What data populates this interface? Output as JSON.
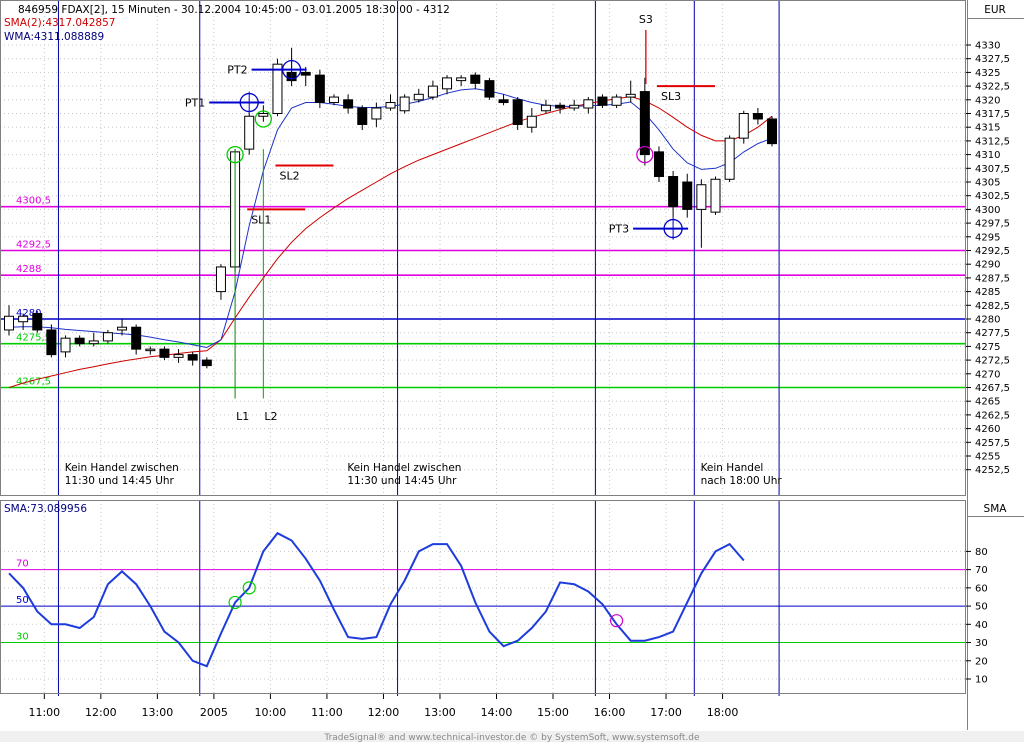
{
  "header": {
    "title": "846959  FDAX[2], 15 Minuten - 30.12.2004 10:45:00 - 03.01.2005 18:30:00 - 4312",
    "sma_label": "SMA(2):4317.042857",
    "wma_label": "WMA:4311.088889",
    "currency": "EUR",
    "title_color": "#000000",
    "sma_color": "#cc0000",
    "wma_color": "#000080"
  },
  "lower_panel": {
    "label": "SMA:73.089956",
    "axis_title": "SMA"
  },
  "footer": {
    "credit": "TradeSignal® and www.technical-investor.de © by SystemSoft, www.systemsoft.de"
  },
  "colors": {
    "up_candle": "#ffffff",
    "down_candle": "#000000",
    "sma_line": "#cc0000",
    "wma_line": "#1e32c8",
    "magenta_level": "#e000e0",
    "green_level": "#00cc00",
    "blue_level": "#0000cc",
    "pt_marker": "#0000cc",
    "sl_marker": "#e00000",
    "entry_circle": "#00cc00",
    "exit_circle": "#cc00cc"
  },
  "chart_data": [
    {
      "type": "candlestick",
      "title": "846959  FDAX[2], 15 Minuten",
      "ylim": [
        4250,
        4335
      ],
      "y_ticks": [
        "4252,5",
        "4255",
        "4257,5",
        "4260",
        "4262,5",
        "4265",
        "4267,5",
        "4270",
        "4272,5",
        "4275",
        "4277,5",
        "4280",
        "4282,5",
        "4285",
        "4287,5",
        "4290",
        "4292,5",
        "4295",
        "4297,5",
        "4300",
        "4302,5",
        "4305",
        "4307,5",
        "4310",
        "4312,5",
        "4315",
        "4317,5",
        "4320",
        "4322,5",
        "4325",
        "4327,5",
        "4330"
      ],
      "x_tick_labels": [
        "11:00",
        "12:00",
        "13:00",
        "2005",
        "10:00",
        "11:00",
        "12:00",
        "13:00",
        "14:00",
        "15:00",
        "16:00",
        "17:00",
        "18:00"
      ],
      "x_tick_bars": [
        2.5,
        6.5,
        10.5,
        14.5,
        18.5,
        22.5,
        26.5,
        30.5,
        34.5,
        38.5,
        42.5,
        46.5,
        50.5
      ],
      "candles": [
        {
          "o": 4278.0,
          "h": 4282.5,
          "l": 4277.0,
          "c": 4280.5
        },
        {
          "o": 4279.5,
          "h": 4281.0,
          "l": 4278.0,
          "c": 4280.5
        },
        {
          "o": 4281.0,
          "h": 4281.5,
          "l": 4277.5,
          "c": 4278.0
        },
        {
          "o": 4278.0,
          "h": 4279.0,
          "l": 4273.0,
          "c": 4273.5
        },
        {
          "o": 4274.0,
          "h": 4277.0,
          "l": 4273.0,
          "c": 4276.5
        },
        {
          "o": 4276.5,
          "h": 4277.0,
          "l": 4275.0,
          "c": 4275.5
        },
        {
          "o": 4275.5,
          "h": 4277.5,
          "l": 4275.0,
          "c": 4276.0
        },
        {
          "o": 4276.0,
          "h": 4278.0,
          "l": 4275.5,
          "c": 4277.5
        },
        {
          "o": 4278.0,
          "h": 4280.0,
          "l": 4277.0,
          "c": 4278.5
        },
        {
          "o": 4278.5,
          "h": 4279.0,
          "l": 4273.5,
          "c": 4274.5
        },
        {
          "o": 4274.5,
          "h": 4275.0,
          "l": 4273.5,
          "c": 4274.5
        },
        {
          "o": 4274.5,
          "h": 4275.0,
          "l": 4272.5,
          "c": 4273.0
        },
        {
          "o": 4273.0,
          "h": 4274.5,
          "l": 4272.0,
          "c": 4273.5
        },
        {
          "o": 4273.5,
          "h": 4274.0,
          "l": 4271.5,
          "c": 4272.5
        },
        {
          "o": 4272.5,
          "h": 4273.0,
          "l": 4271.0,
          "c": 4271.5
        },
        {
          "o": 4285.0,
          "h": 4290.0,
          "l": 4283.5,
          "c": 4289.5
        },
        {
          "o": 4289.5,
          "h": 4311.0,
          "l": 4288.5,
          "c": 4310.5
        },
        {
          "o": 4311.0,
          "h": 4317.5,
          "l": 4310.0,
          "c": 4317.0
        },
        {
          "o": 4317.0,
          "h": 4319.0,
          "l": 4316.0,
          "c": 4317.5
        },
        {
          "o": 4317.5,
          "h": 4327.5,
          "l": 4317.0,
          "c": 4326.5
        },
        {
          "o": 4325.0,
          "h": 4329.5,
          "l": 4322.5,
          "c": 4323.5
        },
        {
          "o": 4325.0,
          "h": 4326.0,
          "l": 4322.5,
          "c": 4324.5
        },
        {
          "o": 4324.5,
          "h": 4325.5,
          "l": 4318.5,
          "c": 4319.5
        },
        {
          "o": 4319.5,
          "h": 4321.0,
          "l": 4319.0,
          "c": 4320.5
        },
        {
          "o": 4320.0,
          "h": 4321.0,
          "l": 4317.5,
          "c": 4318.5
        },
        {
          "o": 4318.5,
          "h": 4319.0,
          "l": 4314.5,
          "c": 4315.5
        },
        {
          "o": 4316.5,
          "h": 4319.5,
          "l": 4315.0,
          "c": 4318.5
        },
        {
          "o": 4318.5,
          "h": 4321.0,
          "l": 4318.0,
          "c": 4319.5
        },
        {
          "o": 4318.0,
          "h": 4321.0,
          "l": 4317.5,
          "c": 4320.5
        },
        {
          "o": 4320.0,
          "h": 4322.0,
          "l": 4319.5,
          "c": 4321.0
        },
        {
          "o": 4320.5,
          "h": 4323.5,
          "l": 4320.0,
          "c": 4322.5
        },
        {
          "o": 4322.0,
          "h": 4324.5,
          "l": 4321.0,
          "c": 4324.0
        },
        {
          "o": 4323.5,
          "h": 4324.5,
          "l": 4322.5,
          "c": 4324.0
        },
        {
          "o": 4324.5,
          "h": 4325.0,
          "l": 4322.0,
          "c": 4323.0
        },
        {
          "o": 4323.5,
          "h": 4324.0,
          "l": 4320.0,
          "c": 4320.5
        },
        {
          "o": 4320.0,
          "h": 4321.0,
          "l": 4319.0,
          "c": 4319.5
        },
        {
          "o": 4320.0,
          "h": 4320.5,
          "l": 4314.5,
          "c": 4315.5
        },
        {
          "o": 4315.0,
          "h": 4318.5,
          "l": 4314.0,
          "c": 4317.0
        },
        {
          "o": 4318.0,
          "h": 4320.0,
          "l": 4317.5,
          "c": 4319.0
        },
        {
          "o": 4319.0,
          "h": 4319.5,
          "l": 4317.5,
          "c": 4318.5
        },
        {
          "o": 4318.5,
          "h": 4320.0,
          "l": 4318.0,
          "c": 4319.0
        },
        {
          "o": 4318.5,
          "h": 4320.5,
          "l": 4317.5,
          "c": 4320.0
        },
        {
          "o": 4320.5,
          "h": 4321.0,
          "l": 4318.5,
          "c": 4319.0
        },
        {
          "o": 4319.0,
          "h": 4321.0,
          "l": 4318.5,
          "c": 4320.5
        },
        {
          "o": 4320.5,
          "h": 4323.5,
          "l": 4319.5,
          "c": 4321.0
        },
        {
          "o": 4321.5,
          "h": 4324.0,
          "l": 4308.0,
          "c": 4310.0
        },
        {
          "o": 4310.5,
          "h": 4311.5,
          "l": 4305.0,
          "c": 4306.0
        },
        {
          "o": 4306.0,
          "h": 4307.0,
          "l": 4298.5,
          "c": 4300.5
        },
        {
          "o": 4305.0,
          "h": 4306.5,
          "l": 4298.5,
          "c": 4300.0
        },
        {
          "o": 4300.0,
          "h": 4305.5,
          "l": 4293.0,
          "c": 4304.5
        },
        {
          "o": 4299.5,
          "h": 4306.0,
          "l": 4299.0,
          "c": 4305.5
        },
        {
          "o": 4305.5,
          "h": 4313.5,
          "l": 4305.0,
          "c": 4313.0
        },
        {
          "o": 4313.0,
          "h": 4318.0,
          "l": 4312.0,
          "c": 4317.5
        },
        {
          "o": 4317.5,
          "h": 4318.5,
          "l": 4315.5,
          "c": 4316.5
        },
        {
          "o": 4316.5,
          "h": 4317.0,
          "l": 4311.5,
          "c": 4312.0
        }
      ],
      "sma_line": [
        4267.5,
        4268.3,
        4269.0,
        4269.6,
        4270.2,
        4270.8,
        4271.3,
        4271.8,
        4272.3,
        4272.7,
        4273.1,
        4273.4,
        4273.7,
        4274.0,
        4274.2,
        4276.2,
        4280.2,
        4284.0,
        4287.5,
        4291.0,
        4294.0,
        4296.5,
        4298.5,
        4300.3,
        4302.0,
        4303.5,
        4305.0,
        4306.5,
        4307.8,
        4309.0,
        4310.0,
        4311.0,
        4312.0,
        4313.0,
        4314.0,
        4315.0,
        4316.0,
        4316.8,
        4317.5,
        4318.2,
        4318.8,
        4319.3,
        4319.8,
        4320.2,
        4320.6,
        4319.8,
        4318.5,
        4316.8,
        4315.0,
        4313.5,
        4312.5,
        4312.5,
        4313.5,
        4315.0,
        4317.0
      ],
      "wma_line": [
        4278.5,
        4278.6,
        4278.6,
        4278.4,
        4278.1,
        4277.9,
        4277.7,
        4277.5,
        4277.3,
        4277.1,
        4276.7,
        4276.2,
        4275.8,
        4275.3,
        4274.8,
        4276.2,
        4285.0,
        4297.0,
        4307.0,
        4314.5,
        4318.5,
        4319.5,
        4319.5,
        4319.2,
        4318.8,
        4318.6,
        4318.6,
        4318.8,
        4319.2,
        4319.7,
        4320.4,
        4321.2,
        4321.8,
        4322.0,
        4321.6,
        4321.0,
        4320.2,
        4319.5,
        4319.0,
        4318.8,
        4318.8,
        4318.9,
        4319.0,
        4319.2,
        4319.6,
        4317.5,
        4314.5,
        4311.0,
        4308.5,
        4307.3,
        4307.5,
        4308.5,
        4310.5,
        4312.0,
        4313.0
      ],
      "levels": [
        {
          "value": 4300.5,
          "label": "4300,5",
          "color": "magenta"
        },
        {
          "value": 4292.5,
          "label": "4292,5",
          "color": "magenta"
        },
        {
          "value": 4288,
          "label": "4288",
          "color": "magenta"
        },
        {
          "value": 4280,
          "label": "4280",
          "color": "blue"
        },
        {
          "value": 4275.5,
          "label": "4275,5",
          "color": "green"
        },
        {
          "value": 4267.5,
          "label": "4267,5",
          "color": "green"
        }
      ],
      "session_separators": [
        3.5,
        13.5,
        27.5,
        41.5,
        48.5,
        54.5
      ],
      "annotations": [
        {
          "text": "PT1",
          "kind": "pt",
          "bar": 17,
          "value": 4319.5
        },
        {
          "text": "PT2",
          "kind": "pt",
          "bar": 20,
          "value": 4325.5
        },
        {
          "text": "PT3",
          "kind": "pt",
          "bar": 47,
          "value": 4296.5
        },
        {
          "text": "SL1",
          "kind": "sl",
          "bar": 17,
          "value": 4300.0
        },
        {
          "text": "SL2",
          "kind": "sl",
          "bar": 19,
          "value": 4308.0
        },
        {
          "text": "SL3",
          "kind": "sl",
          "bar": 46,
          "value": 4322.5
        },
        {
          "text": "L1",
          "kind": "long",
          "bar": 16
        },
        {
          "text": "L2",
          "kind": "long",
          "bar": 18
        },
        {
          "text": "S3",
          "kind": "short",
          "bar": 45
        }
      ],
      "entry_circles": [
        {
          "bar": 16,
          "value": 4310.0
        },
        {
          "bar": 18,
          "value": 4316.5
        }
      ],
      "exit_circles": [
        {
          "bar": 45,
          "value": 4310.0
        }
      ],
      "texts": [
        {
          "lines": [
            "Kein Handel zwischen",
            "11:30 und 14:45 Uhr"
          ],
          "bar": 5.5
        },
        {
          "lines": [
            "Kein Handel zwischen",
            "11:30 und 14:45 Uhr"
          ],
          "bar": 25.5
        },
        {
          "lines": [
            "Kein Handel",
            "nach 18:00 Uhr"
          ],
          "bar": 50.5
        }
      ]
    },
    {
      "type": "line",
      "title": "SMA:73.089956",
      "ylim": [
        0,
        95
      ],
      "y_ticks": [
        "10",
        "20",
        "30",
        "40",
        "50",
        "60",
        "70",
        "80"
      ],
      "levels": [
        {
          "value": 70,
          "label": "70",
          "color": "magenta"
        },
        {
          "value": 50,
          "label": "50",
          "color": "blue"
        },
        {
          "value": 30,
          "label": "30",
          "color": "green"
        }
      ],
      "values": [
        68,
        60,
        47,
        40,
        40,
        38,
        44,
        62,
        69,
        62,
        50,
        36,
        30,
        20,
        17,
        35,
        52,
        60,
        80,
        90,
        86,
        76,
        64,
        48,
        33,
        32,
        33,
        51,
        64,
        80,
        84,
        84,
        72,
        52,
        36,
        28,
        31,
        38,
        47,
        63,
        62,
        58,
        51,
        40,
        31,
        31,
        33,
        36,
        52,
        68,
        80,
        84,
        75
      ],
      "entry_circles": [
        {
          "idx": 16,
          "value": 52
        },
        {
          "idx": 17,
          "value": 60
        }
      ],
      "exit_circles": [
        {
          "idx": 43,
          "value": 42
        }
      ]
    }
  ]
}
